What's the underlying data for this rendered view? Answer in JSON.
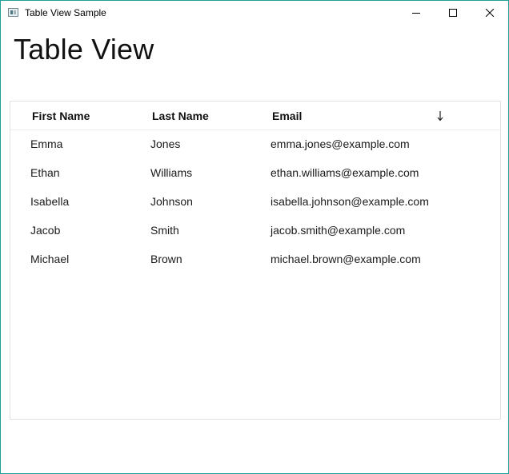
{
  "window": {
    "title": "Table View Sample",
    "accent_color": "#1aa19a",
    "controls": [
      "minimize-icon",
      "maximize-icon",
      "close-icon"
    ]
  },
  "page": {
    "title": "Table View"
  },
  "table": {
    "columns": [
      "First Name",
      "Last Name",
      "Email"
    ],
    "sort_indicator": "↓",
    "rows": [
      {
        "first": "Emma",
        "last": "Jones",
        "email": "emma.jones@example.com"
      },
      {
        "first": "Ethan",
        "last": "Williams",
        "email": "ethan.williams@example.com"
      },
      {
        "first": "Isabella",
        "last": "Johnson",
        "email": "isabella.johnson@example.com"
      },
      {
        "first": "Jacob",
        "last": "Smith",
        "email": "jacob.smith@example.com"
      },
      {
        "first": "Michael",
        "last": "Brown",
        "email": "michael.brown@example.com"
      }
    ]
  }
}
